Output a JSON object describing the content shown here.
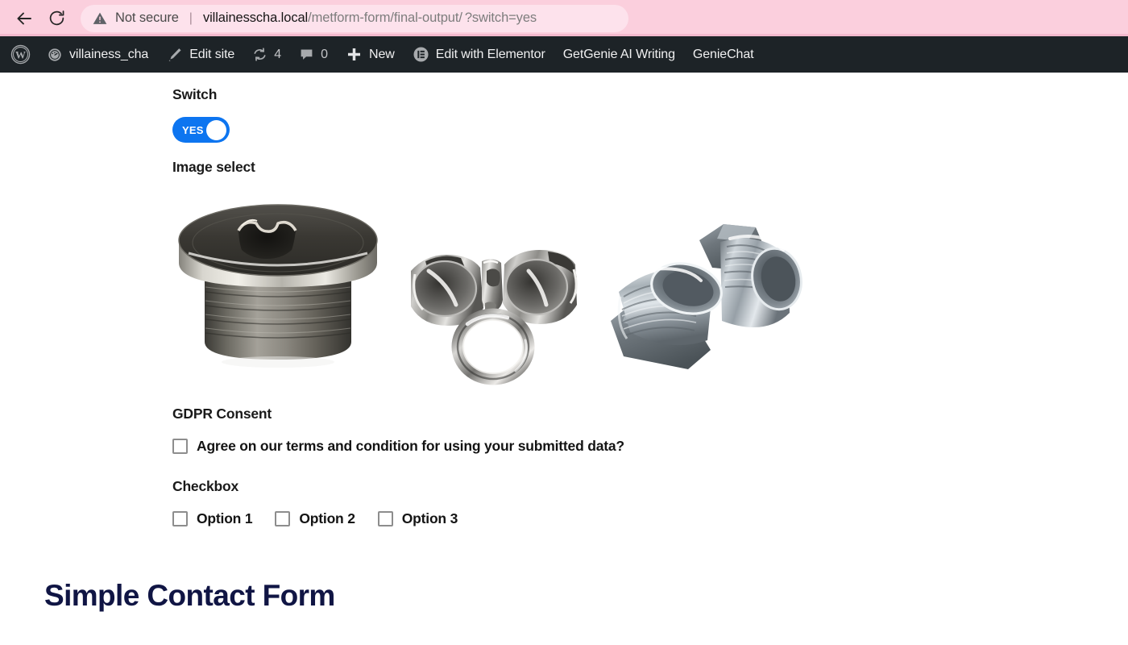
{
  "browser": {
    "back_icon": "back-arrow-icon",
    "reload_icon": "reload-icon",
    "warning_icon": "warning-triangle-icon",
    "security_label": "Not secure",
    "separator": "|",
    "url_host": "villainesscha.local",
    "url_path": "/metform-form/final-output/",
    "url_query": "?switch=yes",
    "highlight_color": "#e8000b",
    "chrome_bg": "#fbcfdd",
    "omnibox_bg": "#fde2ec"
  },
  "adminbar": {
    "bg": "#1d2327",
    "items": [
      {
        "label": "",
        "icon": "wordpress-logo-icon"
      },
      {
        "label": "villainess_cha",
        "icon": "dashboard-speedometer-icon"
      },
      {
        "label": "Edit site",
        "icon": "pencil-paintbrush-icon"
      },
      {
        "label": "4",
        "icon": "updates-refresh-icon"
      },
      {
        "label": "0",
        "icon": "comment-bubble-icon"
      },
      {
        "label": "New",
        "icon": "plus-icon"
      },
      {
        "label": "Edit with Elementor",
        "icon": "elementor-icon"
      },
      {
        "label": "GetGenie AI Writing",
        "icon": ""
      },
      {
        "label": "GenieChat",
        "icon": ""
      }
    ]
  },
  "form": {
    "switch": {
      "label": "Switch",
      "value": "YES",
      "state": "on",
      "accent_color": "#0d75f0"
    },
    "image_select": {
      "label": "Image select",
      "options": [
        {
          "alt": "metal-hex-socket-plug-photo"
        },
        {
          "alt": "metal-fitting-caps-and-ring-photo"
        },
        {
          "alt": "metal-flare-fitting-pair-photo"
        }
      ]
    },
    "gdpr": {
      "label": "GDPR Consent",
      "checkbox_label": "Agree on our terms and condition for using your submitted data?",
      "checked": false
    },
    "checkbox_group": {
      "label": "Checkbox",
      "options": [
        {
          "label": "Option 1",
          "checked": false
        },
        {
          "label": "Option 2",
          "checked": false
        },
        {
          "label": "Option 3",
          "checked": false
        }
      ]
    },
    "next_section_title": "Simple Contact Form"
  }
}
